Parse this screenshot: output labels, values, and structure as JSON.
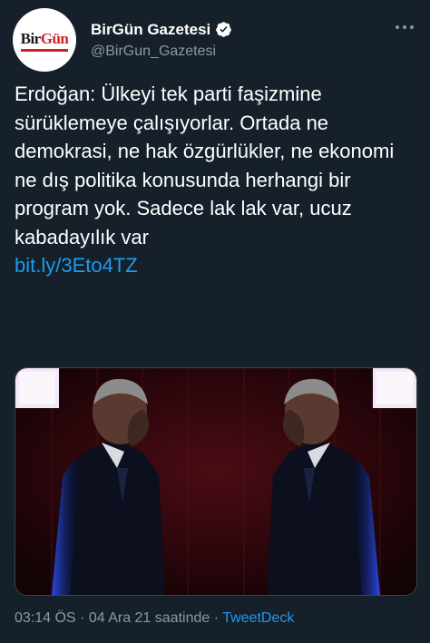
{
  "account": {
    "display_name": "BirGün Gazetesi",
    "handle": "@BirGun_Gazetesi",
    "logo_text_left": "Bir",
    "logo_text_right": "Gün"
  },
  "tweet": {
    "text": "Erdoğan: Ülkeyi tek parti faşizmine sürüklemeye çalışıyorlar. Ortada ne demokrasi, ne hak özgürlükler, ne ekonomi ne dış politika konusunda herhangi bir program yok. Sadece lak lak var, ucuz kabadayılık var",
    "link": "bit.ly/3Eto4TZ"
  },
  "meta": {
    "time": "03:14 ÖS",
    "separator": " · ",
    "date": "04 Ara 21 saatinde",
    "separator2": " · ",
    "source": "TweetDeck"
  },
  "colors": {
    "background": "#15202b",
    "accent": "#1d9bf0",
    "muted": "#8b98a5",
    "logo_red": "#d21f26"
  },
  "icons": {
    "verified": "verified-badge-icon",
    "more": "more-options-icon"
  }
}
